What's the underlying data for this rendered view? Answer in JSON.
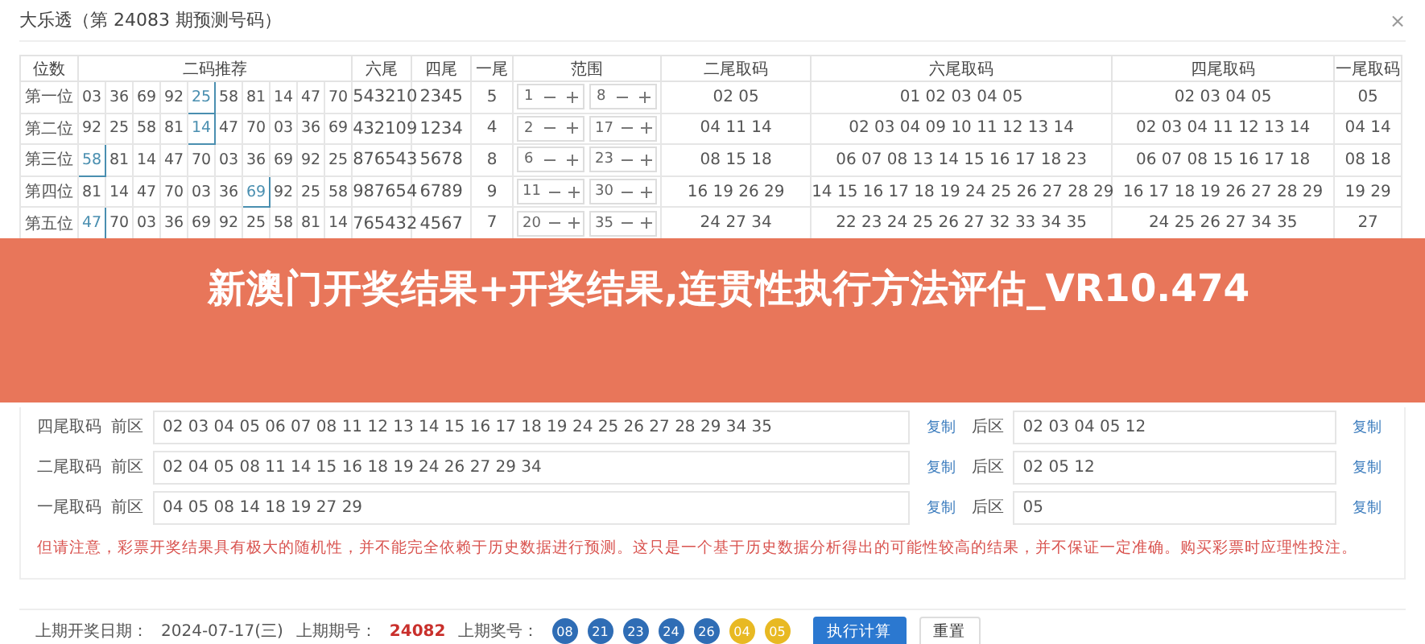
{
  "title": "大乐透（第 24083 期预测号码）",
  "close": "×",
  "table": {
    "columns": [
      "位数",
      "二码推荐",
      "六尾",
      "四尾",
      "一尾",
      "范围",
      "二尾取码",
      "六尾取码",
      "四尾取码",
      "一尾取码"
    ],
    "rows": [
      {
        "position": "第一位",
        "pairs": [
          {
            "text": "03",
            "selected": false
          },
          {
            "text": "36",
            "selected": false
          },
          {
            "text": "69",
            "selected": false
          },
          {
            "text": "92",
            "selected": false
          },
          {
            "text": "25",
            "selected": true
          },
          {
            "text": "58",
            "selected": false
          },
          {
            "text": "81",
            "selected": false
          },
          {
            "text": "14",
            "selected": false
          },
          {
            "text": "47",
            "selected": false
          },
          {
            "text": "70",
            "selected": false
          }
        ],
        "six": "543210",
        "four": "2345",
        "one": "5",
        "range_from": "1",
        "range_to": "8",
        "two_pick": "02 05",
        "six_pick": "01 02 03 04 05",
        "four_pick": "02 03 04 05",
        "one_pick": "05"
      },
      {
        "position": "第二位",
        "pairs": [
          {
            "text": "92",
            "selected": false
          },
          {
            "text": "25",
            "selected": false
          },
          {
            "text": "58",
            "selected": false
          },
          {
            "text": "81",
            "selected": false
          },
          {
            "text": "14",
            "selected": true
          },
          {
            "text": "47",
            "selected": false
          },
          {
            "text": "70",
            "selected": false
          },
          {
            "text": "03",
            "selected": false
          },
          {
            "text": "36",
            "selected": false
          },
          {
            "text": "69",
            "selected": false
          }
        ],
        "six": "432109",
        "four": "1234",
        "one": "4",
        "range_from": "2",
        "range_to": "17",
        "two_pick": "04 11 14",
        "six_pick": "02 03 04 09 10 11 12 13 14",
        "four_pick": "02 03 04 11 12 13 14",
        "one_pick": "04 14"
      },
      {
        "position": "第三位",
        "pairs": [
          {
            "text": "58",
            "selected": true
          },
          {
            "text": "81",
            "selected": false
          },
          {
            "text": "14",
            "selected": false
          },
          {
            "text": "47",
            "selected": false
          },
          {
            "text": "70",
            "selected": false
          },
          {
            "text": "03",
            "selected": false
          },
          {
            "text": "36",
            "selected": false
          },
          {
            "text": "69",
            "selected": false
          },
          {
            "text": "92",
            "selected": false
          },
          {
            "text": "25",
            "selected": false
          }
        ],
        "six": "876543",
        "four": "5678",
        "one": "8",
        "range_from": "6",
        "range_to": "23",
        "two_pick": "08 15 18",
        "six_pick": "06 07 08 13 14 15 16 17 18 23",
        "four_pick": "06 07 08 15 16 17 18",
        "one_pick": "08 18"
      },
      {
        "position": "第四位",
        "pairs": [
          {
            "text": "81",
            "selected": false
          },
          {
            "text": "14",
            "selected": false
          },
          {
            "text": "47",
            "selected": false
          },
          {
            "text": "70",
            "selected": false
          },
          {
            "text": "03",
            "selected": false
          },
          {
            "text": "36",
            "selected": false
          },
          {
            "text": "69",
            "selected": true
          },
          {
            "text": "92",
            "selected": false
          },
          {
            "text": "25",
            "selected": false
          },
          {
            "text": "58",
            "selected": false
          }
        ],
        "six": "987654",
        "four": "6789",
        "one": "9",
        "range_from": "11",
        "range_to": "30",
        "two_pick": "16 19 26 29",
        "six_pick": "14 15 16 17 18 19 24 25 26 27 28 29",
        "four_pick": "16 17 18 19 26 27 28 29",
        "one_pick": "19 29"
      },
      {
        "position": "第五位",
        "pairs": [
          {
            "text": "47",
            "selected": true
          },
          {
            "text": "70",
            "selected": false
          },
          {
            "text": "03",
            "selected": false
          },
          {
            "text": "36",
            "selected": false
          },
          {
            "text": "69",
            "selected": false
          },
          {
            "text": "92",
            "selected": false
          },
          {
            "text": "25",
            "selected": false
          },
          {
            "text": "58",
            "selected": false
          },
          {
            "text": "81",
            "selected": false
          },
          {
            "text": "14",
            "selected": false
          }
        ],
        "six": "765432",
        "four": "4567",
        "one": "7",
        "range_from": "20",
        "range_to": "35",
        "two_pick": "24 27 34",
        "six_pick": "22 23 24 25 26 27 32 33 34 35",
        "four_pick": "24 25 26 27 34 35",
        "one_pick": "27"
      }
    ]
  },
  "banner": "新澳门开奖结果+开奖结果,连贯性执行方法评估_VR10.474",
  "picks": [
    {
      "label": "四尾取码",
      "front_label": "前区",
      "front": "02 03 04 05 06 07 08 11 12 13 14 15 16 17 18 19 24 25 26 27 28 29 34 35",
      "front_copy": "复制",
      "back_label": "后区",
      "back": "02 03 04 05 12",
      "back_copy": "复制"
    },
    {
      "label": "二尾取码",
      "front_label": "前区",
      "front": "02 04 05 08 11 14 15 16 18 19 24 26 27 29 34",
      "front_copy": "复制",
      "back_label": "后区",
      "back": "02 05 12",
      "back_copy": "复制"
    },
    {
      "label": "一尾取码",
      "front_label": "前区",
      "front": "04 05 08 14 18 19 27 29",
      "front_copy": "复制",
      "back_label": "后区",
      "back": "05",
      "back_copy": "复制"
    }
  ],
  "notice": "但请注意，彩票开奖结果具有极大的随机性，并不能完全依赖于历史数据进行预测。这只是一个基于历史数据分析得出的可能性较高的结果，并不保证一定准确。购买彩票时应理性投注。",
  "footer": {
    "date_label": "上期开奖日期：",
    "date": "2024-07-17(三)",
    "issue_label": "上期期号：",
    "issue": "24082",
    "numbers_label": "上期奖号：",
    "balls": [
      {
        "text": "08",
        "color": "#2f6db5"
      },
      {
        "text": "21",
        "color": "#2f6db5"
      },
      {
        "text": "23",
        "color": "#2f6db5"
      },
      {
        "text": "24",
        "color": "#2f6db5"
      },
      {
        "text": "26",
        "color": "#2f6db5"
      },
      {
        "text": "04",
        "color": "#e8b923"
      },
      {
        "text": "05",
        "color": "#e8b923"
      }
    ],
    "run_button": "执行计算",
    "reset_button": "重置"
  }
}
